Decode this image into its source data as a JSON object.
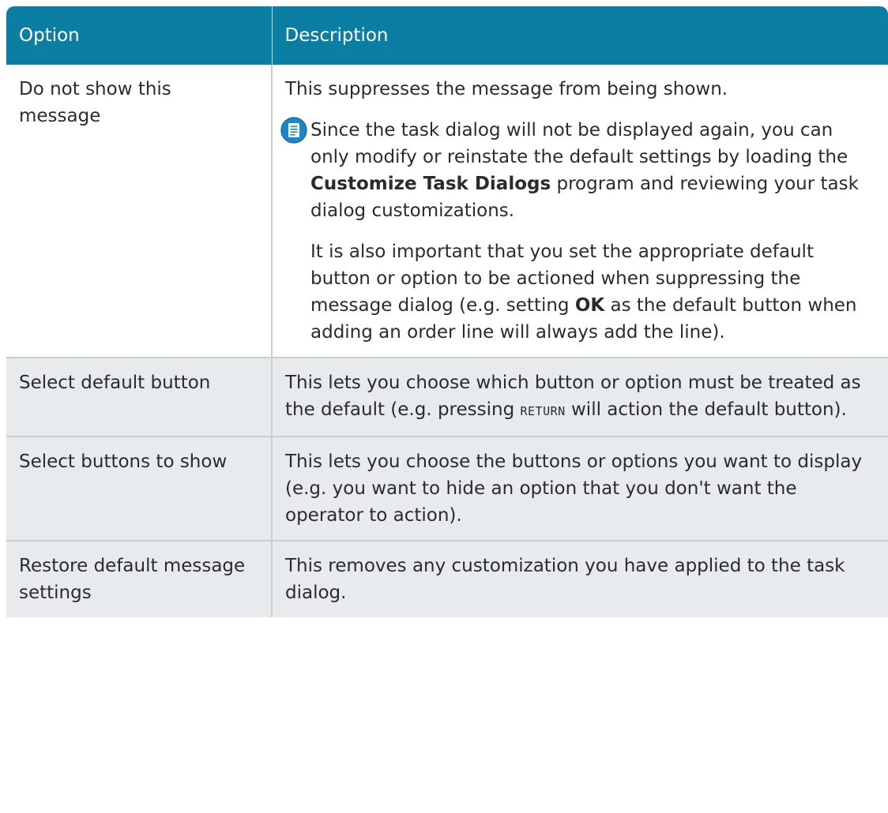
{
  "table": {
    "headers": [
      "Option",
      "Description"
    ],
    "rows": [
      {
        "option": "Do not show this message",
        "description": "This suppresses the message from being shown.",
        "note": {
          "icon": "note-document-icon",
          "para1": {
            "before": "Since the task dialog will not be displayed again, you can only modify or reinstate the default settings by loading the ",
            "bold": "Customize Task Dialogs",
            "after": " program and reviewing your task dialog customizations."
          },
          "para2": {
            "before": "It is also important that you set the appropriate default button or option to be actioned when suppressing the message dialog (e.g. setting ",
            "bold": "OK",
            "after": " as the default button when adding an order line will always add the line)."
          }
        }
      },
      {
        "option": "Select default button",
        "description": {
          "before": "This lets you choose which button or option must be treated as the default (e.g. pressing ",
          "key": "RETURN",
          "after": " will action the default button)."
        }
      },
      {
        "option": "Select buttons to show",
        "description": "This lets you choose the buttons or options you want to display (e.g. you want to hide an option that you don't want the operator to action)."
      },
      {
        "option": "Restore default message settings",
        "description": "This removes any customization you have applied to the task dialog."
      }
    ]
  },
  "colors": {
    "header_bg": "#0a7fa3",
    "header_text": "#ffffff",
    "shaded_row_bg": "#e8ebee",
    "border": "#c9ced3",
    "icon_blue": "#1d86c8"
  }
}
